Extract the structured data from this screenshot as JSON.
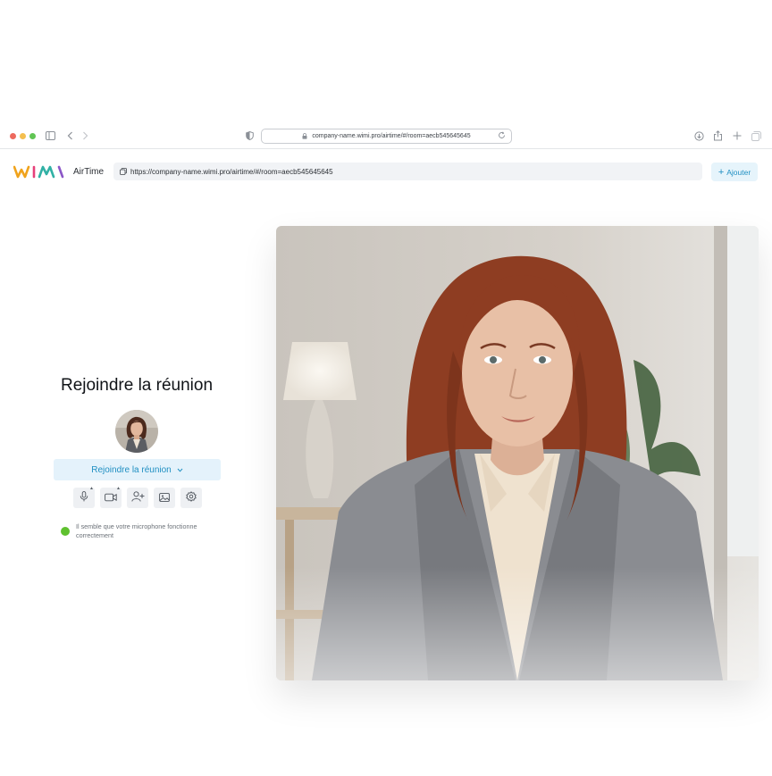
{
  "browser": {
    "address": "company-name.wimi.pro/airtime/#/room=aecb545645645",
    "traffic_lights": [
      "#ed6a5e",
      "#f4bf4f",
      "#61c554"
    ]
  },
  "app": {
    "logo_text": "WIMI",
    "title": "AirTime",
    "room_link": "https://company-name.wimi.pro/airtime/#/room=aecb545645645",
    "add_label": "Ajouter"
  },
  "join": {
    "title": "Rejoindre la réunion",
    "button_label": "Rejoindre la réunion",
    "tools": [
      "microphone-icon",
      "camera-icon",
      "add-user-icon",
      "background-image-icon",
      "settings-icon"
    ],
    "status_text": "Il semble que votre microphone fonctionne correctement",
    "status_color": "#5fc12f"
  },
  "colors": {
    "accent": "#1f8fc2",
    "accent_bg": "#e4f2fb"
  }
}
